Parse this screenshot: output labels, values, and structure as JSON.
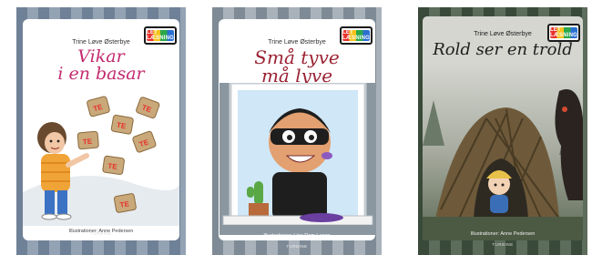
{
  "books": [
    {
      "badge": "LET LÆSNING",
      "author": "Trine Løve Østerbye",
      "title_line1": "Vikar",
      "title_line2": "i en basar",
      "illustrator": "Illustrationer: Anne Pedersen",
      "publisher": "TURBINE",
      "colors": {
        "stripes": "#6f8197",
        "title": "#c22b6f",
        "sweater": "#f0a437",
        "bag": "#c9a87a"
      },
      "illustration": {
        "bag_label": "TE",
        "bag_labels": [
          "TE",
          "TE",
          "TE",
          "TE",
          "TE",
          "TE",
          "TE"
        ]
      }
    },
    {
      "badge": "LET LÆSNING",
      "author": "Trine Løve Østerbye",
      "title_line1": "Små tyve",
      "title_line2": "må lyve",
      "illustrator": "Illustrationer: Line Rom Lange",
      "publisher": "TURBINE",
      "colors": {
        "stripes": "#7e8b96",
        "title": "#9b2334",
        "window": "#cfe7f7"
      }
    },
    {
      "badge": "LET LÆSNING",
      "author": "Trine Løve Østerbye",
      "title_line1": "Rold ser en trold",
      "illustrator": "Illustrationer: Anne Pedersen",
      "publisher": "TURBINE",
      "colors": {
        "stripes": "#3a4a3a",
        "title": "#1f1f1f",
        "hut": "#6e5a3a"
      }
    }
  ]
}
